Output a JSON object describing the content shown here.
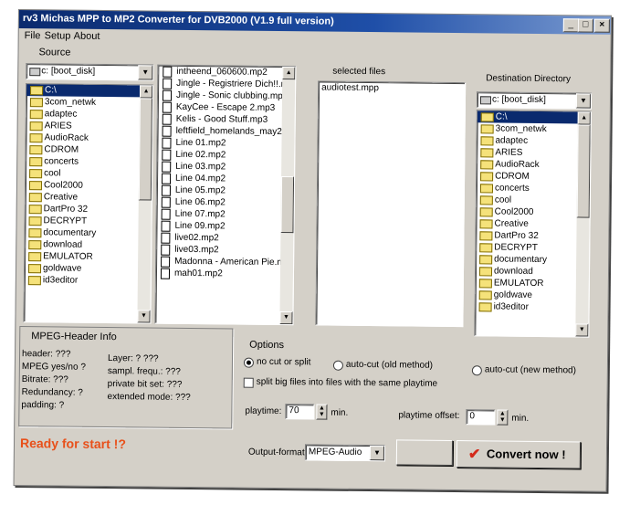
{
  "window": {
    "title": "rv3 Michas MPP to MP2 Converter for DVB2000 (V1.9 full version)"
  },
  "menu": [
    "File",
    "Setup",
    "About"
  ],
  "source": {
    "label": "Source",
    "drive": "c: [boot_disk]",
    "folders": [
      "C:\\",
      "3com_netwk",
      "adaptec",
      "ARIES",
      "AudioRack",
      "CDROM",
      "concerts",
      "cool",
      "Cool2000",
      "Creative",
      "DartPro 32",
      "DECRYPT",
      "documentary",
      "download",
      "EMULATOR",
      "goldwave",
      "id3editor"
    ],
    "files": [
      "intheend_060600.mp2",
      "Jingle - Registriere Dich!!.mp",
      "Jingle - Sonic clubbing.mp3",
      "KayCee - Escape 2.mp3",
      "Kelis - Good Stuff.mp3",
      "leftfield_homelands_may20",
      "Line 01.mp2",
      "Line 02.mp2",
      "Line 03.mp2",
      "Line 04.mp2",
      "Line 05.mp2",
      "Line 06.mp2",
      "Line 07.mp2",
      "Line 09.mp2",
      "live02.mp2",
      "live03.mp2",
      "Madonna - American Pie.m",
      "mah01.mp2"
    ]
  },
  "selected": {
    "label": "selected files",
    "files": [
      "audiotest.mpp"
    ]
  },
  "destination": {
    "label": "Destination Directory",
    "drive": "c: [boot_disk]",
    "folders": [
      "C:\\",
      "3com_netwk",
      "adaptec",
      "ARIES",
      "AudioRack",
      "CDROM",
      "concerts",
      "cool",
      "Cool2000",
      "Creative",
      "DartPro 32",
      "DECRYPT",
      "documentary",
      "download",
      "EMULATOR",
      "goldwave",
      "id3editor"
    ]
  },
  "header_info": {
    "title": "MPEG-Header Info",
    "header": "header: ???",
    "mpeg": "MPEG yes/no ?",
    "bitrate": "Bitrate: ???",
    "redundancy": "Redundancy: ?",
    "padding": "padding: ?",
    "layer": "Layer: ?  ???",
    "sampl": "sampl. frequ.: ???",
    "private": "private bit set: ???",
    "extended": "extended mode: ???"
  },
  "options": {
    "title": "Options",
    "no_cut": "no cut or split",
    "auto_old": "auto-cut (old method)",
    "auto_new": "auto-cut (new method)",
    "split": "split big files into files with the same playtime",
    "playtime_label": "playtime:",
    "playtime_value": "70",
    "playtime_unit": "min.",
    "offset_label": "playtime offset:",
    "offset_value": "0",
    "offset_unit": "min."
  },
  "status": {
    "text": "Ready for start !?",
    "color": "#e8501a"
  },
  "output": {
    "label": "Output-format:",
    "value": "MPEG-Audio"
  },
  "convert": {
    "label": "Convert now !",
    "check_color": "#d42a1a"
  }
}
